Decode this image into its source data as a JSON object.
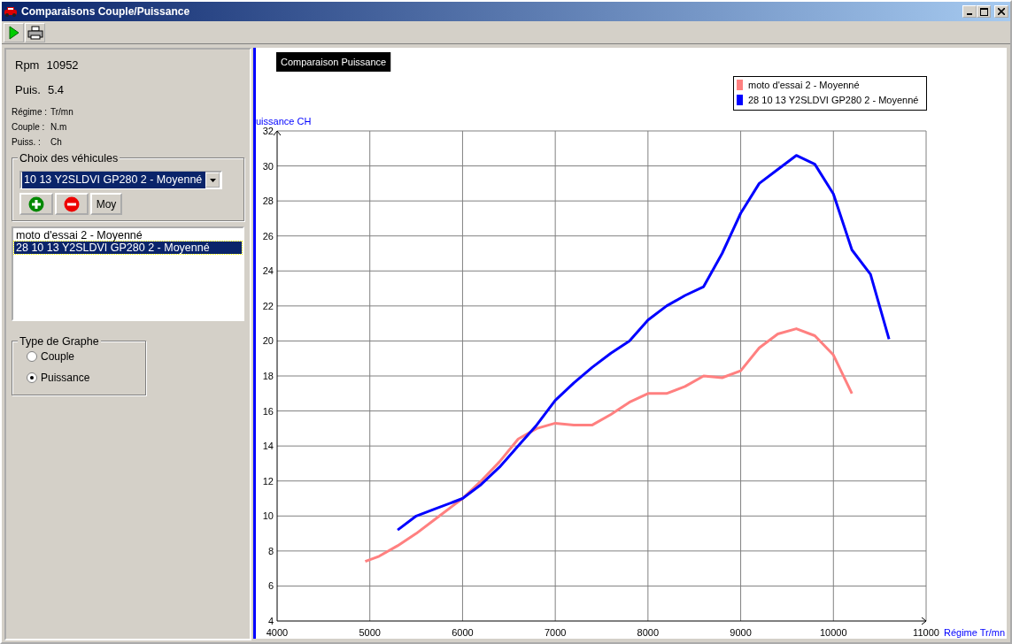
{
  "window": {
    "title": "Comparaisons Couple/Puissance"
  },
  "toolbar": [
    {
      "kind": "play"
    },
    {
      "kind": "print"
    }
  ],
  "readings": [
    {
      "label": "Rpm",
      "value": "10952"
    },
    {
      "label": "Puis.",
      "value": "5.4"
    }
  ],
  "units": [
    {
      "label": "Régime :",
      "unit": "Tr/mn"
    },
    {
      "label": "Couple :",
      "unit": "N.m"
    },
    {
      "label": "Puiss. :",
      "unit": "Ch"
    }
  ],
  "vehicle_choice": {
    "title": "Choix des véhicules",
    "combo_value": "10 13 Y2SLDVI GP280 2 - Moyenné",
    "buttons": [
      {
        "kind": "add"
      },
      {
        "kind": "remove"
      },
      {
        "kind": "text",
        "label": "Moy"
      }
    ]
  },
  "vehicle_list": [
    {
      "label": "moto d'essai 2 - Moyenné",
      "selected": false
    },
    {
      "label": "28 10 13 Y2SLDVI GP280 2 - Moyenné",
      "selected": true
    }
  ],
  "graph_type": {
    "title": "Type de Graphe",
    "options": [
      {
        "label": "Couple",
        "selected": false
      },
      {
        "label": "Puissance",
        "selected": true
      }
    ]
  },
  "chart": {
    "chart_data": {
      "type": "line",
      "title": "Comparaison Puissance",
      "xlabel": "Régime Tr/mn",
      "ylabel": "uissance CH",
      "x": [
        4950,
        5100,
        5300,
        5500,
        5700,
        5900,
        6000,
        6200,
        6400,
        6600,
        6800,
        7000,
        7200,
        7400,
        7600,
        7800,
        8000,
        8200,
        8400,
        8600,
        8800,
        9000,
        9200,
        9400,
        9600,
        9800,
        10000,
        10200,
        10400,
        10600
      ],
      "series": [
        {
          "name": "moto d'essai 2 - Moyenné",
          "color": "#ff8080",
          "values": [
            7.4,
            7.7,
            8.3,
            9.0,
            9.8,
            10.6,
            11.0,
            12.0,
            13.1,
            14.4,
            15.0,
            15.3,
            15.2,
            15.2,
            15.8,
            16.5,
            17.0,
            17.0,
            17.4,
            18.0,
            17.9,
            18.3,
            19.6,
            20.4,
            20.7,
            20.3,
            19.2,
            17.0,
            null,
            null
          ]
        },
        {
          "name": "28 10 13 Y2SLDVI GP280 2 - Moyenné",
          "color": "#0000ff",
          "values": [
            null,
            null,
            9.2,
            10.0,
            10.4,
            10.8,
            11.0,
            11.8,
            12.8,
            14.0,
            15.2,
            16.6,
            17.6,
            18.5,
            19.3,
            20.0,
            21.2,
            22.0,
            22.6,
            23.1,
            25.0,
            27.3,
            29.0,
            29.8,
            30.6,
            30.1,
            28.4,
            25.2,
            23.8,
            20.1
          ]
        }
      ],
      "grid": true,
      "legend": true,
      "xlim": [
        4000,
        11000
      ],
      "ylim": [
        4,
        32
      ],
      "xticks": [
        4000,
        5000,
        6000,
        7000,
        8000,
        9000,
        10000,
        11000
      ],
      "yticks": [
        4,
        6,
        8,
        10,
        12,
        14,
        16,
        18,
        20,
        22,
        24,
        26,
        28,
        30,
        32
      ]
    }
  }
}
